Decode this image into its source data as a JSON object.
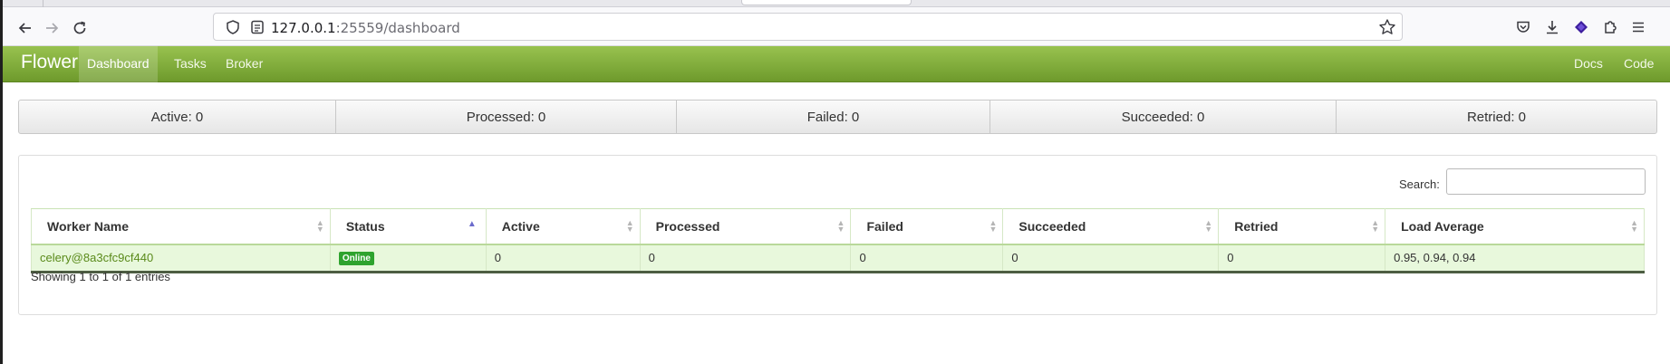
{
  "browser": {
    "url_host": "127.0.0.1",
    "url_path": ":25559/dashboard"
  },
  "app": {
    "brand": "Flower",
    "nav": [
      {
        "label": "Dashboard",
        "active": true
      },
      {
        "label": "Tasks",
        "active": false
      },
      {
        "label": "Broker",
        "active": false
      }
    ],
    "nav_right": [
      {
        "label": "Docs"
      },
      {
        "label": "Code"
      }
    ]
  },
  "stats": [
    {
      "label": "Active: 0"
    },
    {
      "label": "Processed: 0"
    },
    {
      "label": "Failed: 0"
    },
    {
      "label": "Succeeded: 0"
    },
    {
      "label": "Retried: 0"
    }
  ],
  "table": {
    "search_label": "Search:",
    "search_value": "",
    "columns": [
      "Worker Name",
      "Status",
      "Active",
      "Processed",
      "Failed",
      "Succeeded",
      "Retried",
      "Load Average"
    ],
    "rows": [
      {
        "worker_name": "celery@8a3cfc9cf440",
        "status": "Online",
        "active": "0",
        "processed": "0",
        "failed": "0",
        "succeeded": "0",
        "retried": "0",
        "load_average": "0.95, 0.94, 0.94"
      }
    ],
    "info": "Showing 1 to 1 of 1 entries"
  },
  "colors": {
    "navbar": "#7aa634",
    "online_badge": "#2ea32e",
    "row_background": "#e8f8dc",
    "link": "#5a8a1a"
  }
}
